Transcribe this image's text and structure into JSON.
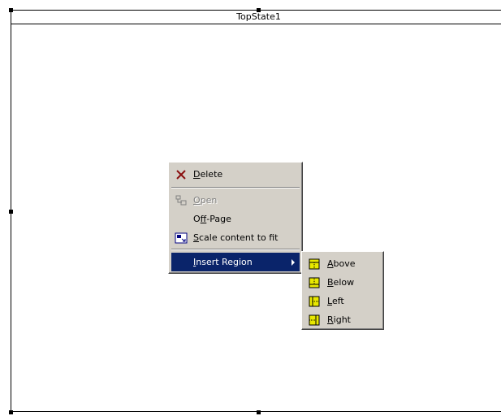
{
  "state": {
    "title": "TopState1"
  },
  "context_menu": {
    "items": [
      {
        "label": "Delete",
        "mnemonic": "D",
        "rest": "elete",
        "icon": "delete-x-icon",
        "enabled": true
      },
      {
        "label": "Open",
        "mnemonic": "O",
        "rest": "pen",
        "icon": "open-icon",
        "enabled": false
      },
      {
        "label": "Off-Page",
        "pre": "O",
        "mnemonic": "f",
        "rest": "f-Page",
        "enabled": true
      },
      {
        "label": "Scale content to fit",
        "mnemonic": "S",
        "rest": "cale content to fit",
        "icon": "scale-to-fit-icon",
        "enabled": true
      },
      {
        "label": "Insert Region",
        "mnemonic": "I",
        "rest": "nsert Region",
        "enabled": true,
        "selected": true,
        "has_submenu": true
      }
    ]
  },
  "insert_region_submenu": {
    "items": [
      {
        "label": "Above",
        "mnemonic": "A",
        "rest": "bove",
        "icon": "region-above-icon"
      },
      {
        "label": "Below",
        "mnemonic": "B",
        "rest": "elow",
        "icon": "region-below-icon"
      },
      {
        "label": "Left",
        "mnemonic": "L",
        "rest": "eft",
        "icon": "region-left-icon"
      },
      {
        "label": "Right",
        "mnemonic": "R",
        "rest": "ight",
        "icon": "region-right-icon"
      }
    ]
  },
  "colors": {
    "menu_bg": "#d4d0c8",
    "highlight": "#0a246a",
    "region_icon_fill": "#e8e800"
  }
}
